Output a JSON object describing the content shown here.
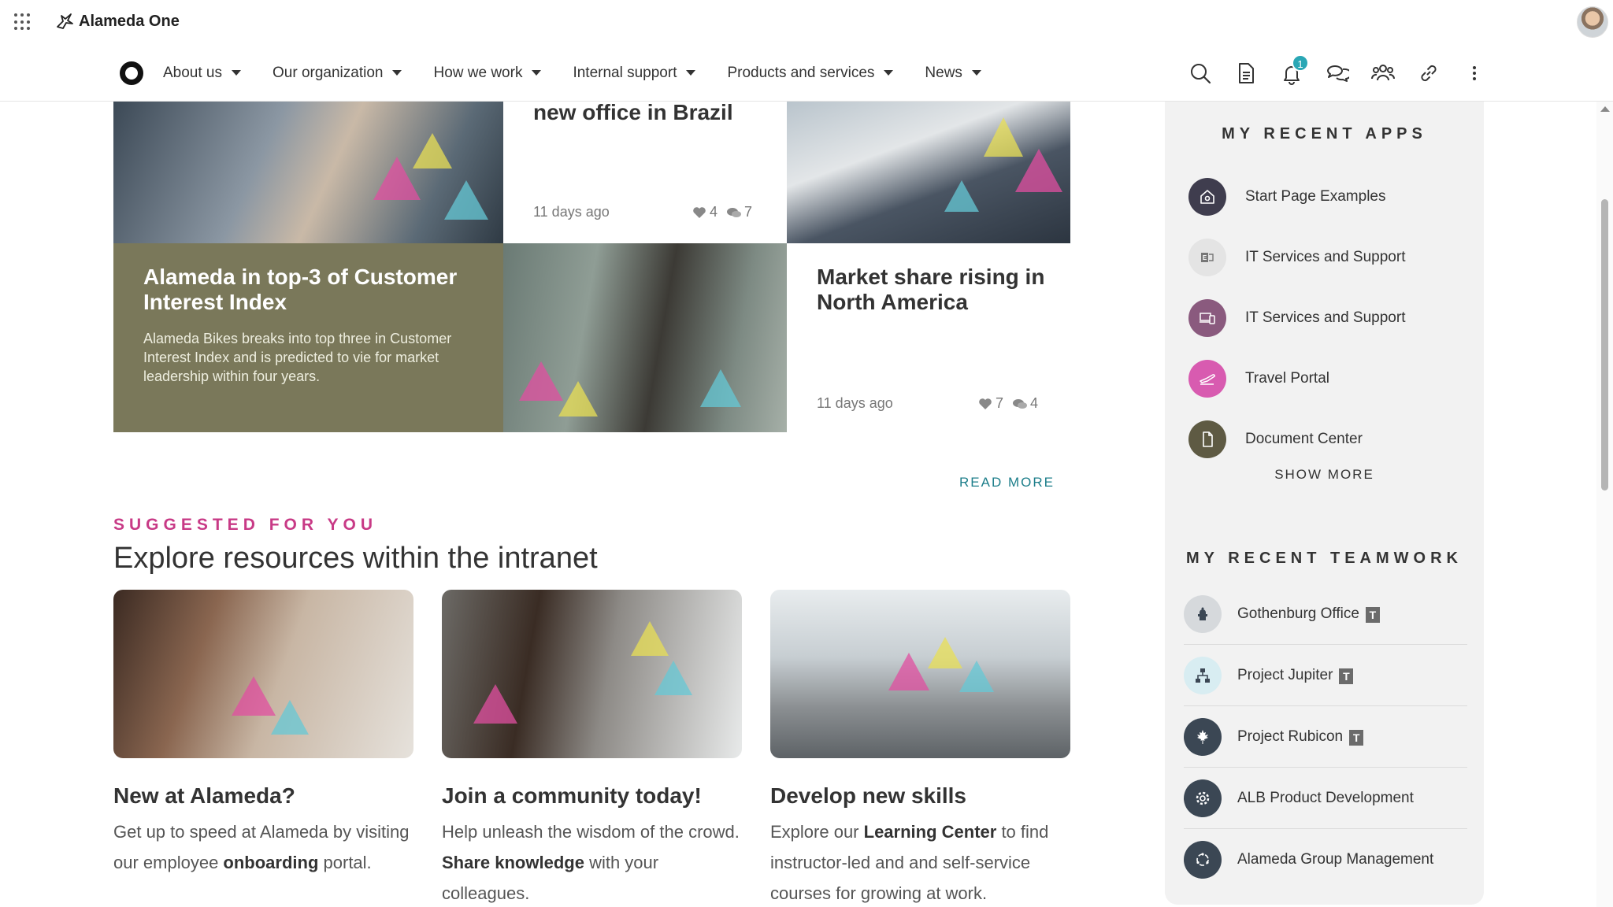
{
  "app": {
    "brand": "Alameda One"
  },
  "nav": {
    "items": [
      {
        "label": "About us"
      },
      {
        "label": "Our organization"
      },
      {
        "label": "How we work"
      },
      {
        "label": "Internal support"
      },
      {
        "label": "Products and services"
      },
      {
        "label": "News"
      }
    ],
    "tools": {
      "search": "search-icon",
      "document": "document-icon",
      "notifications": "bell-icon",
      "notification_count": "1",
      "chat": "chat-icon",
      "people": "people-icon",
      "links": "link-icon",
      "more": "more-vertical-icon"
    }
  },
  "news": {
    "brazil": {
      "title": "new office in Brazil",
      "time": "11 days ago",
      "likes": "4",
      "comments": "7"
    },
    "index": {
      "title": "Alameda in top-3 of Customer Interest Index",
      "desc": "Alameda Bikes breaks into top three in Customer Interest Index and is predicted to vie for market leadership within four years."
    },
    "market": {
      "title": "Market share rising in North America",
      "time": "11 days ago",
      "likes": "7",
      "comments": "4"
    },
    "read_more": "READ MORE"
  },
  "suggested": {
    "kicker": "SUGGESTED FOR YOU",
    "title": "Explore resources within the intranet",
    "cards": [
      {
        "title": "New at Alameda?",
        "desc_pre": "Get up to speed at Alameda by visiting our employee ",
        "desc_bold": "onboarding",
        "desc_post": " portal."
      },
      {
        "title": "Join a community today!",
        "desc_pre": "Help unleash the wisdom of the crowd. ",
        "desc_bold": "Share knowledge",
        "desc_post": " with your colleagues."
      },
      {
        "title": "Develop new skills",
        "desc_pre": "Explore our ",
        "desc_bold": "Learning Center",
        "desc_post": " to find instructor-led and and self-service courses for growing at work."
      }
    ]
  },
  "recent_apps": {
    "heading": "MY RECENT APPS",
    "items": [
      {
        "label": "Start Page Examples",
        "icon": "home-settings-icon",
        "color": "#3f3d4e"
      },
      {
        "label": "IT Services and Support",
        "icon": "exchange-icon",
        "color": "#e4e4e4"
      },
      {
        "label": "IT Services and Support",
        "icon": "devices-icon",
        "color": "#8a5a7e"
      },
      {
        "label": "Travel Portal",
        "icon": "plane-icon",
        "color": "#d85bb0"
      },
      {
        "label": "Document Center",
        "icon": "file-icon",
        "color": "#5e5a43"
      }
    ],
    "show_more": "SHOW MORE"
  },
  "recent_teamwork": {
    "heading": "MY RECENT TEAMWORK",
    "items": [
      {
        "label": "Gothenburg Office",
        "icon": "hydrant-icon",
        "color": "#d6d9dc",
        "teams": true
      },
      {
        "label": "Project Jupiter",
        "icon": "org-chart-icon",
        "color": "#d8edf2",
        "teams": true
      },
      {
        "label": "Project Rubicon",
        "icon": "maple-leaf-icon",
        "color": "#3b4754",
        "teams": true
      },
      {
        "label": "ALB Product Development",
        "icon": "gear-icon",
        "color": "#3b4754",
        "teams": false
      },
      {
        "label": "Alameda Group Management",
        "icon": "cycle-icon",
        "color": "#3b4754",
        "teams": false
      }
    ]
  }
}
